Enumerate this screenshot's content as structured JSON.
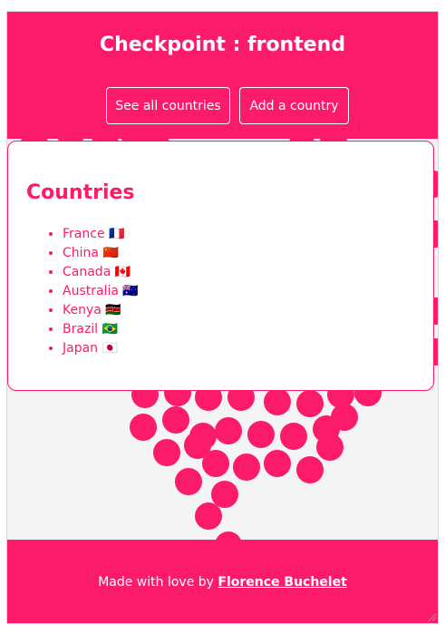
{
  "colors": {
    "accent": "#fc1a6a",
    "background": "#f4f4f4"
  },
  "header": {
    "title": "Checkpoint : frontend",
    "nav": [
      {
        "label": "See all countries"
      },
      {
        "label": "Add a country"
      }
    ]
  },
  "main": {
    "heading": "Countries",
    "countries": [
      {
        "name": "France",
        "flag": "🇫🇷"
      },
      {
        "name": "China",
        "flag": "🇨🇳"
      },
      {
        "name": "Canada",
        "flag": "🇨🇦"
      },
      {
        "name": "Australia",
        "flag": "🇦🇺"
      },
      {
        "name": "Kenya",
        "flag": "🇰🇪"
      },
      {
        "name": "Brazil",
        "flag": "🇧🇷"
      },
      {
        "name": "Japan",
        "flag": "🇯🇵"
      }
    ]
  },
  "footer": {
    "prefix": "Made with love by",
    "author": "Florence Buchelet"
  }
}
